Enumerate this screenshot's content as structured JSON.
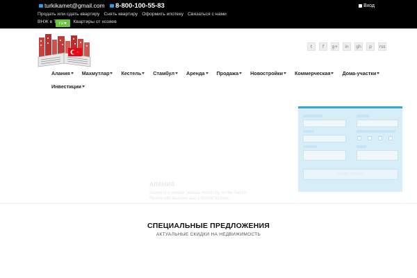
{
  "topbar": {
    "email": "turkikamet@gmail.com",
    "phone": "8-800-100-55-83",
    "login": "Вход",
    "links": [
      "Продать или сдать квартиру",
      "Снять квартиру",
      "Оформить ипотеку",
      "Связаться с нами",
      "ВНЖ в Турции",
      "Квартиры от хозяев"
    ],
    "language": "ru",
    "colors": {
      "background": "#000000",
      "accent": "#2e9de6",
      "language_badge": "#6cc33f"
    }
  },
  "social": [
    "twitter-icon",
    "facebook-icon",
    "google-plus-icon",
    "linkedin-icon",
    "github-icon",
    "pinterest-icon",
    "rss-icon"
  ],
  "social_glyphs": [
    "t",
    "f",
    "g+",
    "in",
    "gh",
    "p",
    "rss"
  ],
  "nav": [
    {
      "label": "Алания"
    },
    {
      "label": "Махмутлар"
    },
    {
      "label": "Кестель"
    },
    {
      "label": "Стамбул"
    },
    {
      "label": "Аренда"
    },
    {
      "label": "Продажа"
    },
    {
      "label": "Новостройки"
    },
    {
      "label": "Коммерческая"
    },
    {
      "label": "Дома-участки"
    },
    {
      "label": "Инвестиции"
    }
  ],
  "hero": {
    "title": "АЛАНИЯ",
    "description": "Alanya is a popular seaside resort city on the Turkish Riviera with beaches and a historic fortress."
  },
  "search": {
    "colors": {
      "panel": "#d7eef9",
      "border": "#35a6dc"
    },
    "button": "НАЙТИ ОБЪЕКТ"
  },
  "special": {
    "title": "СПЕЦИАЛЬНЫЕ ПРЕДЛОЖЕНИЯ",
    "subtitle": "АКТУАЛЬНЫЕ СКИДКИ НА НЕДВИЖИМОСТЬ"
  }
}
